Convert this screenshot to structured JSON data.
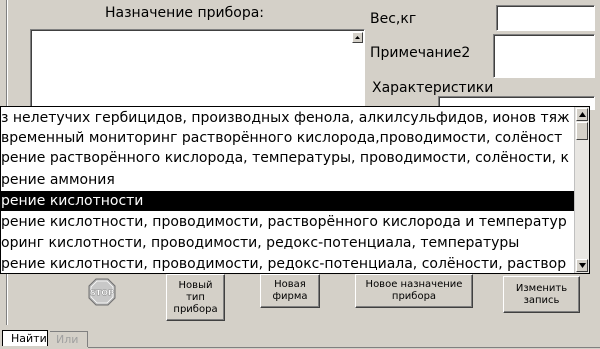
{
  "form": {
    "purpose_label": "Назначение прибора:",
    "weight_label": "Вес,кг",
    "note2_label": "Примечание2",
    "characteristics_label": "Характеристики"
  },
  "dropdown": {
    "items": [
      "з нелетучих гербицидов, производных фенола, алкилсульфидов, ионов тяж",
      "временный мониторинг растворённого кислорода,проводимости, солёност",
      "рение растворённого кислорода, температуры, проводимости, солёности, к",
      "рение аммония",
      "рение кислотности",
      "рение кислотности, проводимости, растворённого кислорода и температур",
      "оринг кислотности, проводимости, редокс-потенциала, температуры",
      "рение кислотности, проводимости, редокс-потенциала, солёности, раствор"
    ],
    "selected_index": 4
  },
  "buttons": {
    "stop_icon": "stop-icon",
    "new_type": "Новый\nтип\nприбора",
    "new_firm": "Новая\nфирма",
    "new_purpose": "Новое назначение\nприбора",
    "edit_record": "Изменить\nзапись"
  },
  "tabs": {
    "find": "Найти",
    "other": "Или"
  },
  "colors": {
    "background": "#d4d0c8",
    "selection": "#000000",
    "stop_red": "#c0c0c0"
  }
}
